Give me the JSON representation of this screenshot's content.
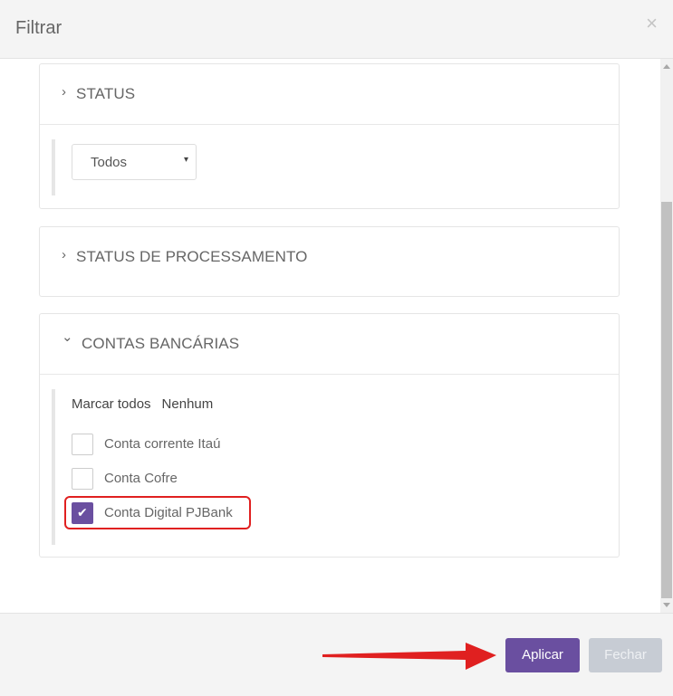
{
  "dialog": {
    "title": "Filtrar",
    "close_glyph": "×"
  },
  "panels": {
    "status": {
      "label": "STATUS",
      "chevron": "›",
      "select_value": "Todos",
      "caret": "▾"
    },
    "processing": {
      "label": "STATUS DE PROCESSAMENTO",
      "chevron": "›"
    },
    "accounts": {
      "label": "CONTAS BANCÁRIAS",
      "chevron": "⌄",
      "select_all": "Marcar todos",
      "select_none": "Nenhum",
      "items": [
        {
          "label": "Conta corrente Itaú",
          "checked": false
        },
        {
          "label": "Conta Cofre",
          "checked": false
        },
        {
          "label": "Conta Digital PJBank",
          "checked": true
        }
      ],
      "check_glyph": "✔"
    }
  },
  "footer": {
    "apply_label": "Aplicar",
    "close_label": "Fechar"
  },
  "colors": {
    "accent": "#6a4fa0",
    "annotation": "#e02020",
    "disabled": "#c7ccd4"
  }
}
